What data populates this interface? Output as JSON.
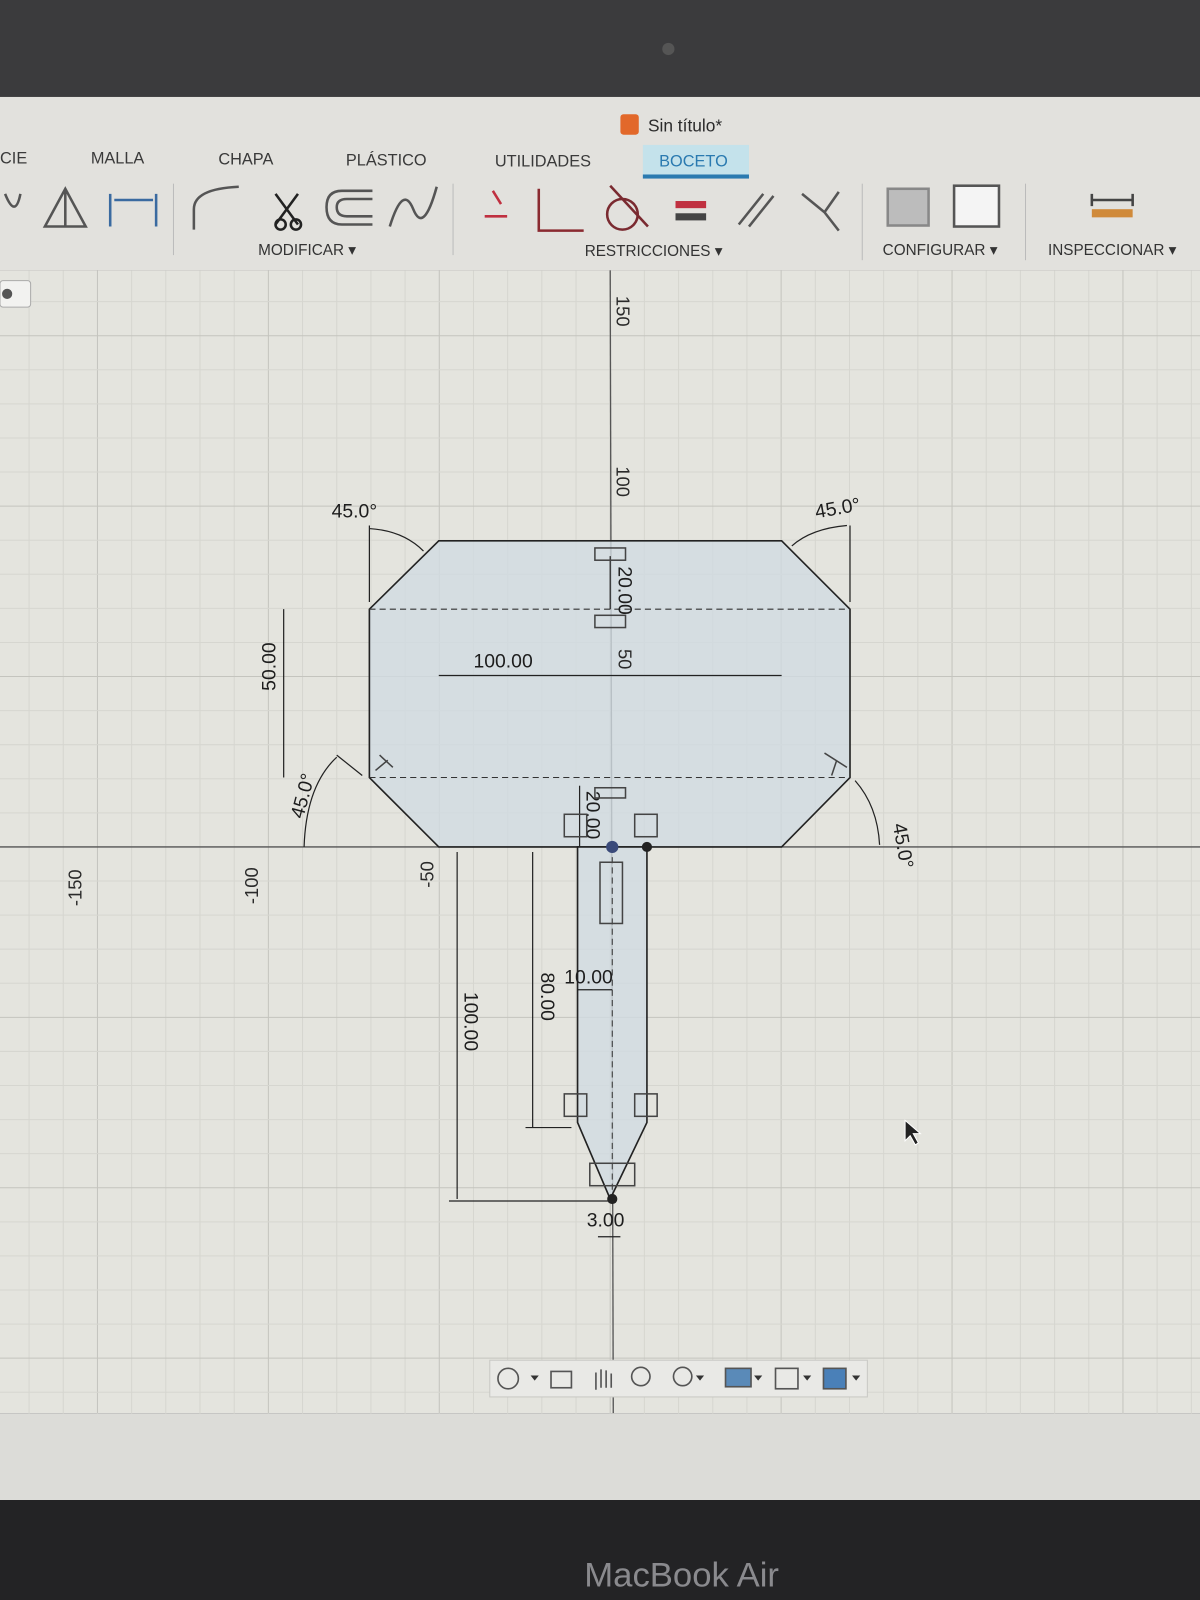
{
  "window": {
    "title": "Sin título*"
  },
  "tabs": [
    {
      "label": "CIE"
    },
    {
      "label": "MALLA"
    },
    {
      "label": "CHAPA"
    },
    {
      "label": "PLÁSTICO"
    },
    {
      "label": "UTILIDADES"
    },
    {
      "label": "BOCETO",
      "active": true
    }
  ],
  "toolbar_groups": {
    "modify": "MODIFICAR ▾",
    "constraints": "RESTRICCIONES ▾",
    "configure": "CONFIGURAR ▾",
    "inspect": "INSPECCIONAR ▾"
  },
  "axis_labels": {
    "y150": "150",
    "y100": "100",
    "y50": "50",
    "xm50": "-50",
    "xm100": "-100",
    "xm150": "-150"
  },
  "dimensions": {
    "angle_top_left": "45.0°",
    "angle_top_right": "45.0°",
    "angle_bottom_left": "45.0°",
    "angle_bottom_right": "45.0°",
    "height_side": "50.00",
    "width_inner": "100.00",
    "top_offset": "20.00",
    "bottom_offset": "20.00",
    "handle_width": "10.00",
    "handle_length": "80.00",
    "total_length": "100.00",
    "tip_width": "3.00"
  },
  "colors": {
    "accent": "#2a7ab0",
    "active_tab_bg": "#bfe0ea",
    "canvas": "#e4e4de",
    "sketch_fill": "#d3dde3"
  },
  "device_label": "MacBook Air"
}
